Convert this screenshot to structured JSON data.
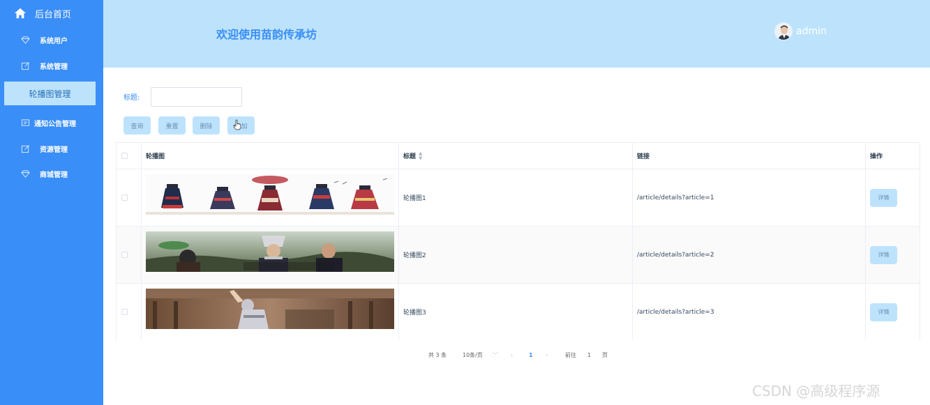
{
  "sidebar": {
    "home_label": "后台首页",
    "items": [
      {
        "label": "系统用户",
        "icon": "diamond-icon"
      },
      {
        "label": "系统管理",
        "icon": "edit-icon"
      },
      {
        "label": "轮播图管理",
        "icon": "",
        "active": true
      },
      {
        "label": "通知公告管理",
        "icon": "message-icon"
      },
      {
        "label": "资源管理",
        "icon": "edit-icon"
      },
      {
        "label": "商城管理",
        "icon": "diamond-icon"
      }
    ]
  },
  "header": {
    "welcome": "欢迎使用苗韵传承坊",
    "username": "admin"
  },
  "search": {
    "label": "标题:",
    "value": "",
    "placeholder": ""
  },
  "toolbar": {
    "query": "查询",
    "reset": "重置",
    "delete": "删除",
    "add": "添加"
  },
  "table": {
    "columns": [
      "轮播图",
      "标题",
      "链接",
      "操作"
    ],
    "rows": [
      {
        "title": "轮播图1",
        "link": "/article/details?article=1",
        "action": "详情"
      },
      {
        "title": "轮播图2",
        "link": "/article/details?article=2",
        "action": "详情"
      },
      {
        "title": "轮播图3",
        "link": "/article/details?article=3",
        "action": "详情"
      }
    ]
  },
  "pagination": {
    "total": "共 3 条",
    "page_size": "10条/页",
    "current": "1",
    "goto_prefix": "前往",
    "goto_value": "1",
    "goto_suffix": "页"
  },
  "watermark": "CSDN @高级程序源",
  "colors": {
    "sidebar": "#3a8ef8",
    "header": "#bde3fc",
    "accent": "#3a8ef8",
    "button": "#bde3fc"
  }
}
